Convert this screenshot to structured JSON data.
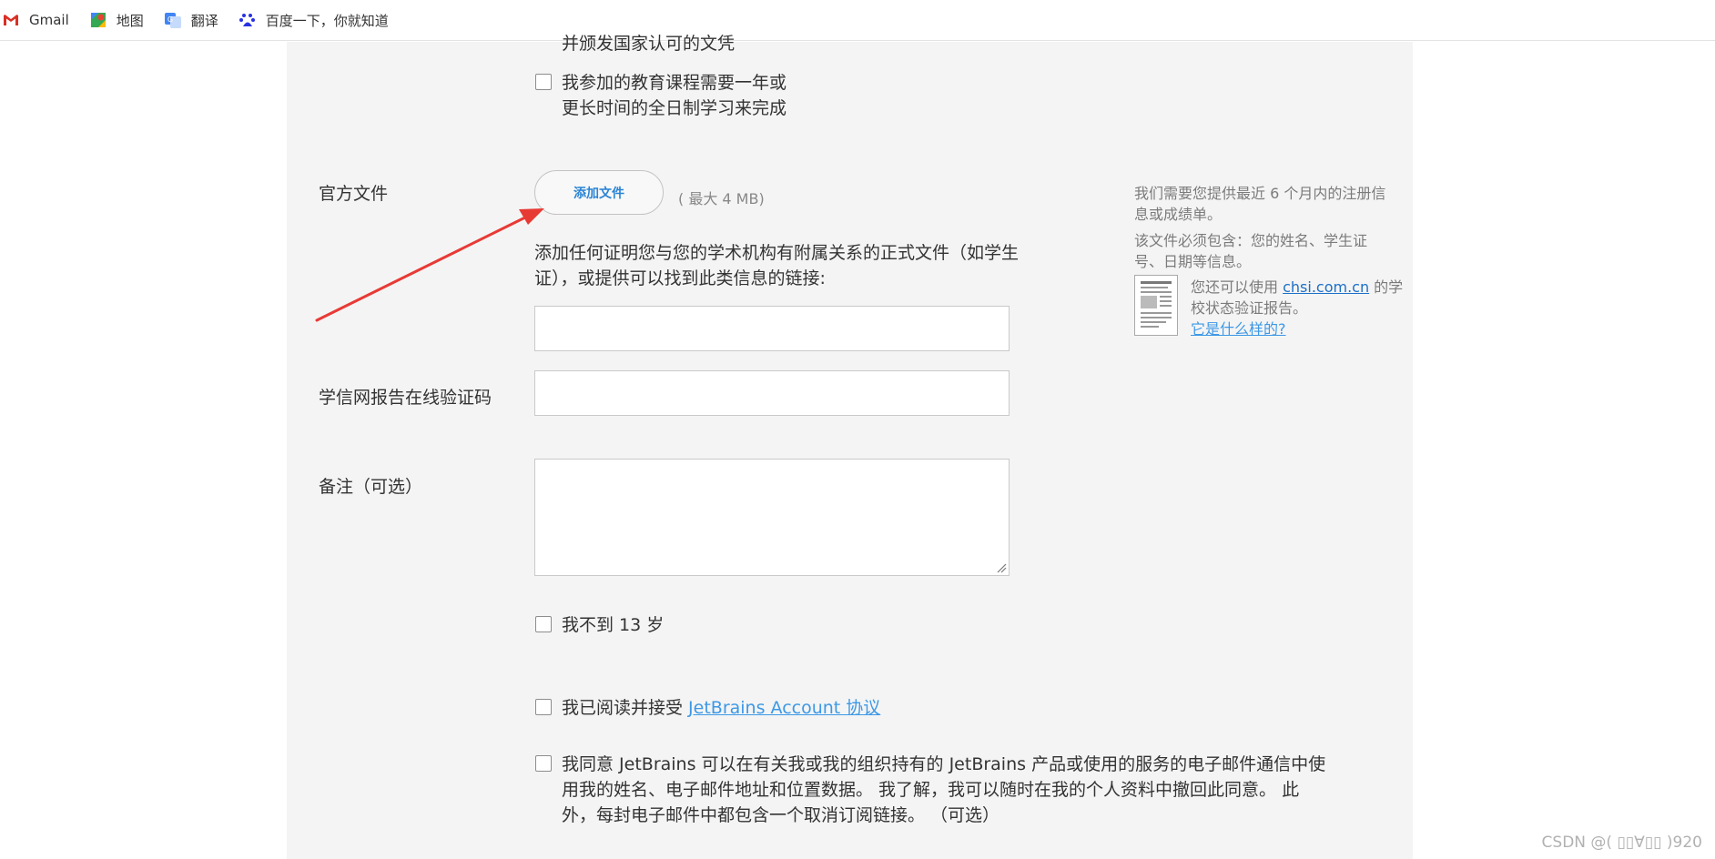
{
  "bookmarks": [
    {
      "label": "Gmail",
      "icon": "gmail-icon"
    },
    {
      "label": "地图",
      "icon": "maps-icon"
    },
    {
      "label": "翻译",
      "icon": "translate-icon"
    },
    {
      "label": "百度一下，你就知道",
      "icon": "baidu-icon"
    }
  ],
  "form": {
    "partial_top_line": "并颁发国家认可的文凭",
    "fulltime_line1": "我参加的教育课程需要一年或",
    "fulltime_line2": "更长时间的全日制学习来完成",
    "official_doc_label": "官方文件",
    "add_file_button": "添加文件",
    "max_size": "( 最大 4 MB)",
    "doc_desc_line1": "添加任何证明您与您的学术机构有附属关系的正式文件（如学生",
    "doc_desc_line2": "证），或提供可以找到此类信息的链接:",
    "doc_link_value": "",
    "chsi_label": "学信网报告在线验证码",
    "chsi_value": "",
    "notes_label": "备注（可选）",
    "notes_value": "",
    "under13": "我不到 13 岁",
    "agree_prefix": "我已阅读并接受 ",
    "agree_link": "JetBrains Account 协议",
    "consent_line1": "我同意 JetBrains 可以在有关我或我的组织持有的 JetBrains 产品或使用的服务的电子邮件通信中使",
    "consent_line2": "用我的姓名、电子邮件地址和位置数据。 我了解，我可以随时在我的个人资料中撤回此同意。 此",
    "consent_line3": "外，每封电子邮件中都包含一个取消订阅链接。 （可选）"
  },
  "side_info": {
    "p1_line1": "我们需要您提供最近 6 个月内的注册信",
    "p1_line2": "息或成绩单。",
    "p2_line1": "该文件必须包含：您的姓名、学生证",
    "p2_line2": "号、日期等信息。",
    "p3_prefix": "您还可以使用 ",
    "p3_link": "chsi.com.cn",
    "p3_suffix": " 的学",
    "p3_line2": "校状态验证报告。",
    "p3_example_link": "它是什么样的?"
  },
  "watermark": "CSDN @( ▯▯∀▯▯ )920",
  "colors": {
    "panel_bg": "#f4f4f4",
    "link": "#1d70c8",
    "arrow": "#e83a35"
  }
}
